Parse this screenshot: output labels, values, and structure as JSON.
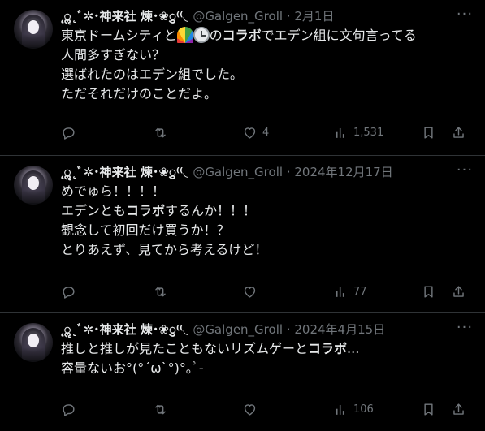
{
  "tweets": [
    {
      "name": "˛ॢ˛ﾞ✲･神来社 煉･❀ु⁽⁽◟",
      "handle": "@Galgen_Groll",
      "separator": "·",
      "date": "2月1日",
      "more_label": "···",
      "text_segments": [
        {
          "text": "東京ドームシティと",
          "bold": false
        },
        {
          "emoji": "rainbow"
        },
        {
          "emoji": "clock"
        },
        {
          "text": "の",
          "bold": false
        },
        {
          "text": "コラボ",
          "bold": true
        },
        {
          "text": "でエデン組に文句言ってる\n人間多すぎない？\n選ばれたのはエデン組でした。\nただそれだけのことだよ。",
          "bold": false
        }
      ],
      "actions": {
        "reply": "",
        "retweet": "",
        "like": "4",
        "views": "1,531"
      }
    },
    {
      "name": "˛ॢ˛ﾞ✲･神来社 煉･❀ु⁽⁽◟",
      "handle": "@Galgen_Groll",
      "separator": "·",
      "date": "2024年12月17日",
      "more_label": "···",
      "text_segments": [
        {
          "text": "めでゅら！！！！\nエデンとも",
          "bold": false
        },
        {
          "text": "コラボ",
          "bold": true
        },
        {
          "text": "するんか！！！\n観念して初回だけ買うか！？\nとりあえず、見てから考えるけど！",
          "bold": false
        }
      ],
      "actions": {
        "reply": "",
        "retweet": "",
        "like": "",
        "views": "77"
      }
    },
    {
      "name": "˛ॢ˛ﾞ✲･神来社 煉･❀ु⁽⁽◟",
      "handle": "@Galgen_Groll",
      "separator": "·",
      "date": "2024年4月15日",
      "more_label": "···",
      "text_segments": [
        {
          "text": "推しと推しが見たこともないリズムゲーと",
          "bold": false
        },
        {
          "text": "コラボ",
          "bold": true
        },
        {
          "text": "...\n容量ないお°(°´ω`°)°｡ﾟ-",
          "bold": false
        }
      ],
      "actions": {
        "reply": "",
        "retweet": "",
        "like": "",
        "views": "106"
      }
    }
  ],
  "icons": [
    "avatar",
    "more-icon",
    "reply-icon",
    "retweet-icon",
    "like-icon",
    "views-icon",
    "bookmark-icon",
    "share-icon"
  ],
  "colors": {
    "background": "#000000",
    "text": "#e7e9ea",
    "muted": "#71767b",
    "divider": "#2f3336"
  }
}
